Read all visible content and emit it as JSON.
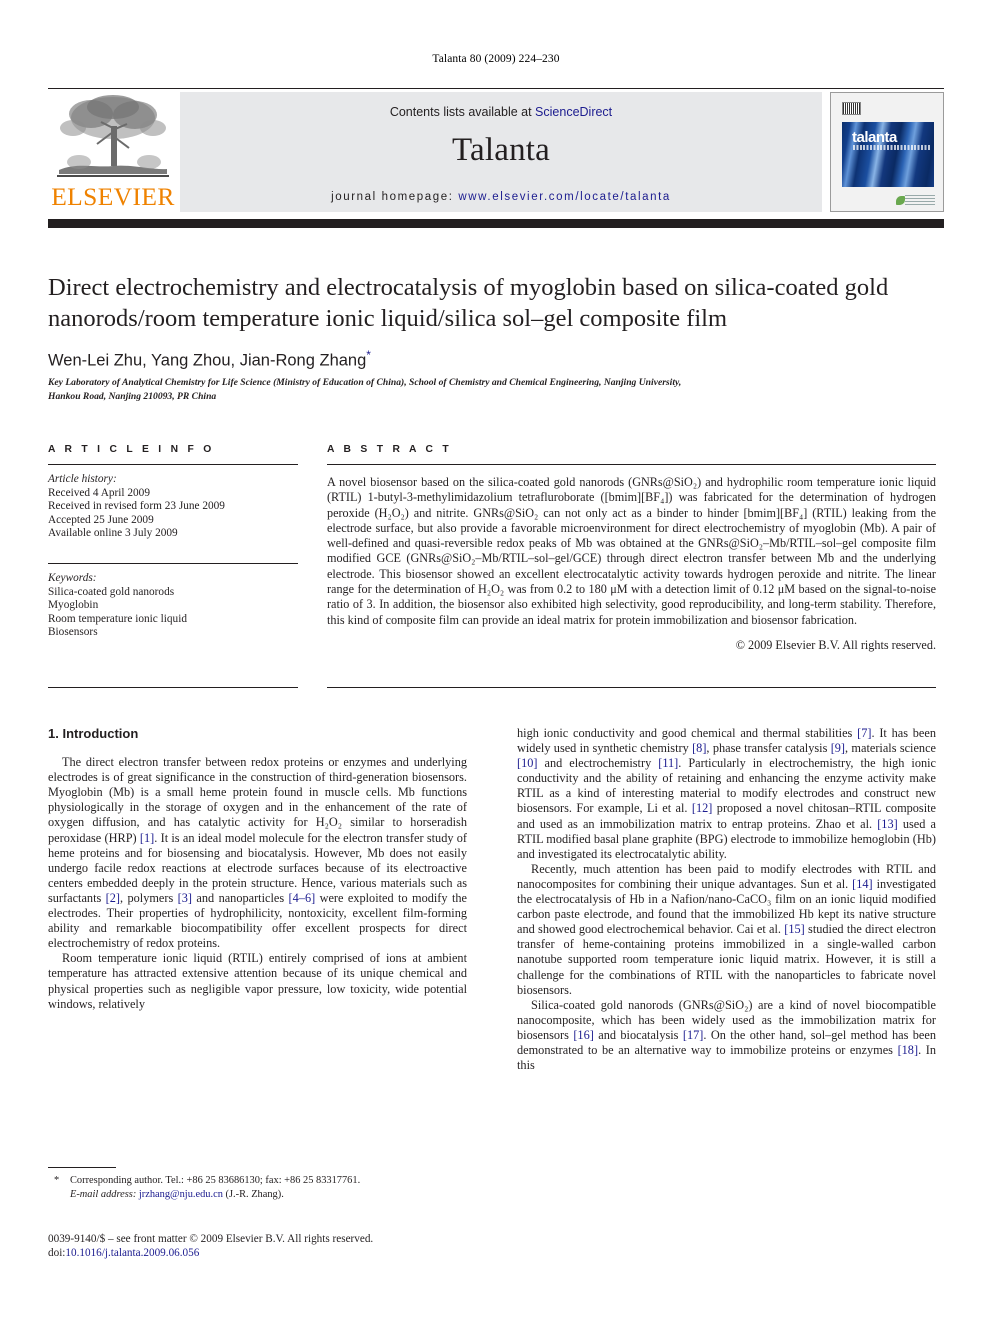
{
  "running_head": "Talanta 80 (2009) 224–230",
  "masthead": {
    "publisher_name": "ELSEVIER",
    "publisher_logo_icon": "elsevier-tree-icon",
    "contents_prefix": "Contents lists available at ",
    "contents_link": "ScienceDirect",
    "journal_name": "Talanta",
    "homepage_prefix": "journal homepage: ",
    "homepage_url": "www.elsevier.com/locate/talanta",
    "cover": {
      "title": "talanta",
      "barcode_icon": "barcode-icon",
      "leaf_icon": "leaf-icon"
    },
    "accent_orange": "#ef8200",
    "link_blue": "#1c1c8f",
    "band_gray": "#e7e8ea",
    "bar_black": "#231f20"
  },
  "article": {
    "title": "Direct electrochemistry and electrocatalysis of myoglobin based on silica-coated gold nanorods/room temperature ionic liquid/silica sol–gel composite film",
    "authors": "Wen-Lei Zhu, Yang Zhou, Jian-Rong Zhang",
    "corresponding_marker": "*",
    "affiliation_line1": "Key Laboratory of Analytical Chemistry for Life Science (Ministry of Education of China), School of Chemistry and Chemical Engineering, Nanjing University,",
    "affiliation_line2": "Hankou Road, Nanjing 210093, PR China"
  },
  "article_info": {
    "heading": "A R T I C L E   I N F O",
    "history_label": "Article history:",
    "history": [
      "Received 4 April 2009",
      "Received in revised form 23 June 2009",
      "Accepted 25 June 2009",
      "Available online 3 July 2009"
    ],
    "keywords_label": "Keywords:",
    "keywords": [
      "Silica-coated gold nanorods",
      "Myoglobin",
      "Room temperature ionic liquid",
      "Biosensors"
    ]
  },
  "abstract": {
    "heading": "A B S T R A C T",
    "text": "A novel biosensor based on the silica-coated gold nanorods (GNRs@SiO₂) and hydrophilic room temperature ionic liquid (RTIL) 1-butyl-3-methylimidazolium tetrafluroborate ([bmim][BF₄]) was fabricated for the determination of hydrogen peroxide (H₂O₂) and nitrite. GNRs@SiO₂ can not only act as a binder to hinder [bmim][BF₄] (RTIL) leaking from the electrode surface, but also provide a favorable microenvironment for direct electrochemistry of myoglobin (Mb). A pair of well-defined and quasi-reversible redox peaks of Mb was obtained at the GNRs@SiO₂–Mb/RTIL–sol–gel composite film modified GCE (GNRs@SiO₂–Mb/RTIL–sol–gel/GCE) through direct electron transfer between Mb and the underlying electrode. This biosensor showed an excellent electrocatalytic activity towards hydrogen peroxide and nitrite. The linear range for the determination of H₂O₂ was from 0.2 to 180 μM with a detection limit of 0.12 μM based on the signal-to-noise ratio of 3. In addition, the biosensor also exhibited high selectivity, good reproducibility, and long-term stability. Therefore, this kind of composite film can provide an ideal matrix for protein immobilization and biosensor fabrication.",
    "copyright": "© 2009 Elsevier B.V. All rights reserved."
  },
  "introduction": {
    "heading": "1.  Introduction",
    "left_paragraphs": [
      "The direct electron transfer between redox proteins or enzymes and underlying electrodes is of great significance in the construction of third-generation biosensors. Myoglobin (Mb) is a small heme protein found in muscle cells. Mb functions physiologically in the storage of oxygen and in the enhancement of the rate of oxygen diffusion, and has catalytic activity for H₂O₂ similar to horseradish peroxidase (HRP) [1]. It is an ideal model molecule for the electron transfer study of heme proteins and for biosensing and biocatalysis. However, Mb does not easily undergo facile redox reactions at electrode surfaces because of its electroactive centers embedded deeply in the protein structure. Hence, various materials such as surfactants [2], polymers [3] and nanoparticles [4–6] were exploited to modify the electrodes. Their properties of hydrophilicity, nontoxicity, excellent film-forming ability and remarkable biocompatibility offer excellent prospects for direct electrochemistry of redox proteins.",
      "Room temperature ionic liquid (RTIL) entirely comprised of ions at ambient temperature has attracted extensive attention because of its unique chemical and physical properties such as negligible vapor pressure, low toxicity, wide potential windows, relatively"
    ],
    "right_paragraphs": [
      "high ionic conductivity and good chemical and thermal stabilities [7]. It has been widely used in synthetic chemistry [8], phase transfer catalysis [9], materials science [10] and electrochemistry [11]. Particularly in electrochemistry, the high ionic conductivity and the ability of retaining and enhancing the enzyme activity make RTIL as a kind of interesting material to modify electrodes and construct new biosensors. For example, Li et al. [12] proposed a novel chitosan–RTIL composite and used as an immobilization matrix to entrap proteins. Zhao et al. [13] used a RTIL modified basal plane graphite (BPG) electrode to immobilize hemoglobin (Hb) and investigated its electrocatalytic ability.",
      "Recently, much attention has been paid to modify electrodes with RTIL and nanocomposites for combining their unique advantages. Sun et al. [14] investigated the electrocatalysis of Hb in a Nafion/nano-CaCO₃ film on an ionic liquid modified carbon paste electrode, and found that the immobilized Hb kept its native structure and showed good electrochemical behavior. Cai et al. [15] studied the direct electron transfer of heme-containing proteins immobilized in a single-walled carbon nanotube supported room temperature ionic liquid matrix. However, it is still a challenge for the combinations of RTIL with the nanoparticles to fabricate novel biosensors.",
      "Silica-coated gold nanorods (GNRs@SiO₂) are a kind of novel biocompatible nanocomposite, which has been widely used as the immobilization matrix for biosensors [16] and biocatalysis [17]. On the other hand, sol–gel method has been demonstrated to be an alternative way to immobilize proteins or enzymes [18]. In this"
    ]
  },
  "footnotes": {
    "corresponding_marker": "*",
    "corresponding_text": "Corresponding author. Tel.: +86 25 83686130; fax: +86 25 83317761.",
    "email_label": "E-mail address:",
    "email": "jrzhang@nju.edu.cn",
    "email_suffix": "(J.-R. Zhang)."
  },
  "imprint": {
    "line1": "0039-9140/$ – see front matter © 2009 Elsevier B.V. All rights reserved.",
    "doi_label": "doi:",
    "doi_value": "10.1016/j.talanta.2009.06.056"
  }
}
